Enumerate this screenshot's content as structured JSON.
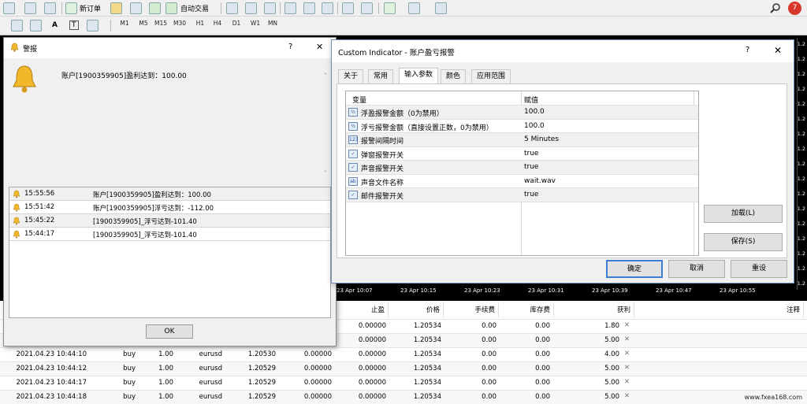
{
  "toolbar": {
    "new_order": "新订单",
    "auto_trading": "自动交易",
    "timeframes": [
      "M1",
      "M5",
      "M15",
      "M30",
      "H1",
      "H4",
      "D1",
      "W1",
      "MN"
    ],
    "notif_count": "7",
    "text_tool": "A",
    "textlabel_tool": "T"
  },
  "chart": {
    "date_ticks": [
      "23 Apr 10:07",
      "23 Apr 10:15",
      "23 Apr 10:23",
      "23 Apr 10:31",
      "23 Apr 10:39",
      "23 Apr 10:47",
      "23 Apr 10:55"
    ],
    "price_labels": [
      "1.2",
      "1.2",
      "1.2",
      "1.2",
      "1.2",
      "1.2",
      "1.2",
      "1.2",
      "1.2",
      "1.2",
      "1.2",
      "1.2",
      "1.2",
      "1.2",
      "1.2",
      "1.2",
      "1.2"
    ]
  },
  "alert": {
    "title": "警报",
    "help": "?",
    "close": "✕",
    "message": "账户[1900359905]盈利达到：100.00",
    "rows": [
      {
        "time": "15:55:56",
        "text": "账户[1900359905]盈利达到：100.00"
      },
      {
        "time": "15:51:42",
        "text": "账户[1900359905]浮亏达到：-112.00"
      },
      {
        "time": "15:45:22",
        "text": "[1900359905]_浮亏达到-101.40"
      },
      {
        "time": "15:44:17",
        "text": "[1900359905]_浮亏达到-101.40"
      }
    ],
    "ok": "OK"
  },
  "dialog": {
    "title": "Custom Indicator - 账户盈亏报警",
    "help": "?",
    "close": "✕",
    "tabs": [
      "关于",
      "常用",
      "输入参数",
      "颜色",
      "应用范围"
    ],
    "col_var": "变量",
    "col_val": "赋值",
    "params": [
      {
        "icon": "½",
        "name": "浮盈报警金额（0为禁用）",
        "value": "100.0"
      },
      {
        "icon": "½",
        "name": "浮亏报警金额（直接设置正数，0为禁用）",
        "value": "100.0"
      },
      {
        "icon": "123",
        "name": "报警间隔时间",
        "value": "5 Minutes"
      },
      {
        "icon": "✓",
        "name": "弹窗报警开关",
        "value": "true"
      },
      {
        "icon": "✓",
        "name": "声音报警开关",
        "value": "true"
      },
      {
        "icon": "ab",
        "name": "声音文件名称",
        "value": "wait.wav"
      },
      {
        "icon": "✓",
        "name": "邮件报警开关",
        "value": "true"
      }
    ],
    "load": "加载(L)",
    "save": "保存(S)",
    "ok": "确定",
    "cancel": "取消",
    "reset": "重设"
  },
  "orders": {
    "headers": [
      "止盈",
      "价格",
      "手续费",
      "库存费",
      "获利",
      "注释"
    ],
    "rows": [
      {
        "time": "",
        "type": "",
        "size": "",
        "symbol": "",
        "price": "",
        "sl": "",
        "tp": "0.00000",
        "cur": "1.20534",
        "comm": "0.00",
        "swap": "0.00",
        "profit": "1.80"
      },
      {
        "time": "",
        "type": "",
        "size": "",
        "symbol": "",
        "price": "",
        "sl": "",
        "tp": "0.00000",
        "cur": "1.20534",
        "comm": "0.00",
        "swap": "0.00",
        "profit": "5.00"
      },
      {
        "time": "2021.04.23 10:44:10",
        "type": "buy",
        "size": "1.00",
        "symbol": "eurusd",
        "price": "1.20530",
        "sl": "0.00000",
        "tp": "0.00000",
        "cur": "1.20534",
        "comm": "0.00",
        "swap": "0.00",
        "profit": "4.00"
      },
      {
        "time": "2021.04.23 10:44:12",
        "type": "buy",
        "size": "1.00",
        "symbol": "eurusd",
        "price": "1.20529",
        "sl": "0.00000",
        "tp": "0.00000",
        "cur": "1.20534",
        "comm": "0.00",
        "swap": "0.00",
        "profit": "5.00"
      },
      {
        "time": "2021.04.23 10:44:17",
        "type": "buy",
        "size": "1.00",
        "symbol": "eurusd",
        "price": "1.20529",
        "sl": "0.00000",
        "tp": "0.00000",
        "cur": "1.20534",
        "comm": "0.00",
        "swap": "0.00",
        "profit": "5.00"
      },
      {
        "time": "2021.04.23 10:44:18",
        "type": "buy",
        "size": "1.00",
        "symbol": "eurusd",
        "price": "1.20529",
        "sl": "0.00000",
        "tp": "0.00000",
        "cur": "1.20534",
        "comm": "0.00",
        "swap": "0.00",
        "profit": "5.00"
      }
    ],
    "close_glyph": "✕"
  },
  "watermark": "www.fxea168.com",
  "colors": {
    "accent": "#3c7fd2",
    "chart_bg": "#000000",
    "bell": "#f2b82b"
  }
}
